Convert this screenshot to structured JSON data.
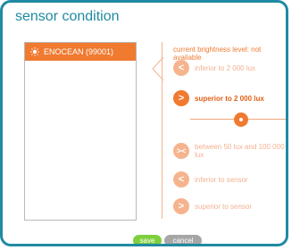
{
  "dialog": {
    "title": "sensor condition"
  },
  "sensors": [
    {
      "label": "ENOCEAN (99001)",
      "icon": "sun-icon"
    }
  ],
  "status": {
    "brightness_text": "current brightness level: not available"
  },
  "options": [
    {
      "label": "inferior to 2 000 lux",
      "symbol": "<",
      "active": false
    },
    {
      "label": "superior to 2 000 lux",
      "symbol": ">",
      "active": true
    },
    {
      "label": "between 50 lux and 100 000 lux",
      "symbol": "><",
      "active": false
    },
    {
      "label": "inferior to sensor",
      "symbol": "<",
      "active": false
    },
    {
      "label": "superior to sensor",
      "symbol": ">",
      "active": false
    }
  ],
  "slider": {
    "value_fraction": 0.5
  },
  "buttons": {
    "save": "save",
    "cancel": "cancel"
  },
  "colors": {
    "accent": "#f07a30",
    "title": "#1f8aa2",
    "save": "#7ecf3c",
    "cancel": "#a6a6a6"
  }
}
